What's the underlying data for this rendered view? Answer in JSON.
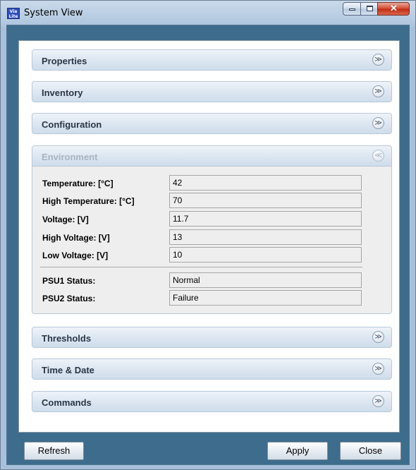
{
  "window": {
    "title": "System View",
    "app_icon_text": "Via Lite"
  },
  "sections": {
    "properties": "Properties",
    "inventory": "Inventory",
    "configuration": "Configuration",
    "environment": "Environment",
    "thresholds": "Thresholds",
    "time_date": "Time & Date",
    "commands": "Commands"
  },
  "icons": {
    "collapsed": "chevron-double-down-icon",
    "expanded": "chevron-double-up-icon",
    "chev_down_glyph": "»",
    "chev_up_glyph": "«"
  },
  "environment": {
    "temperature_label": "Temperature: [°C]",
    "temperature_value": "42",
    "high_temperature_label": "High Temperature: [°C]",
    "high_temperature_value": "70",
    "voltage_label": "Voltage: [V]",
    "voltage_value": "11.7",
    "high_voltage_label": "High Voltage: [V]",
    "high_voltage_value": "13",
    "low_voltage_label": "Low Voltage: [V]",
    "low_voltage_value": "10",
    "psu1_label": "PSU1 Status:",
    "psu1_value": "Normal",
    "psu2_label": "PSU2 Status:",
    "psu2_value": "Failure"
  },
  "buttons": {
    "refresh": "Refresh",
    "apply": "Apply",
    "close": "Close"
  },
  "colors": {
    "client_background": "#3d6c8c",
    "close_button": "#c8341c"
  }
}
